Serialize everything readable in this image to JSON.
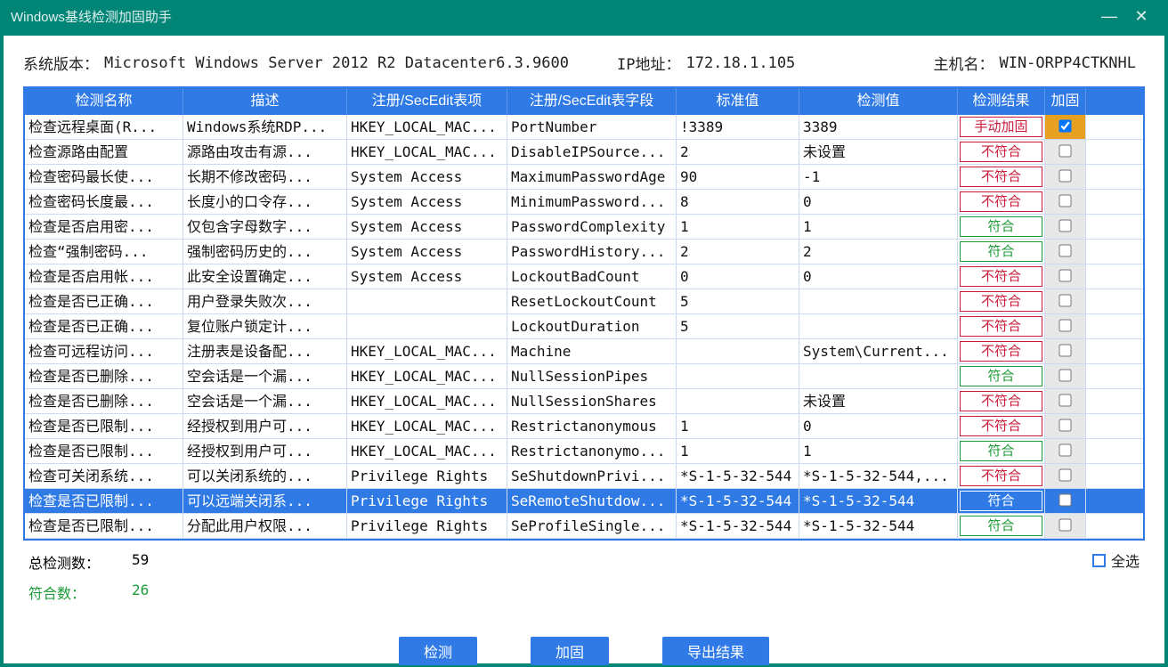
{
  "titlebar": {
    "title": "Windows基线检测加固助手"
  },
  "info": {
    "os_label": "系统版本：",
    "os_value": "Microsoft Windows Server 2012 R2 Datacenter6.3.9600",
    "ip_label": "IP地址：",
    "ip_value": "172.18.1.105",
    "host_label": "主机名：",
    "host_value": "WIN-ORPP4CTKNHL"
  },
  "columns": [
    "检测名称",
    "描述",
    "注册/SecEdit表项",
    "注册/SecEdit表字段",
    "标准值",
    "检测值",
    "检测结果",
    "加固"
  ],
  "results": {
    "ok": "符合",
    "bad": "不符合",
    "manual": "手动加固"
  },
  "rows": [
    {
      "name": "检查远程桌面(R...",
      "desc": "Windows系统RDP...",
      "reg": "HKEY_LOCAL_MAC...",
      "field": "PortNumber",
      "std": "!3389",
      "val": "3389",
      "res": "manual",
      "chk": true,
      "hl": true
    },
    {
      "name": "检查源路由配置",
      "desc": "源路由攻击有源...",
      "reg": "HKEY_LOCAL_MAC...",
      "field": "DisableIPSource...",
      "std": "2",
      "val": "未设置",
      "res": "bad",
      "chk": false
    },
    {
      "name": "检查密码最长使...",
      "desc": "长期不修改密码...",
      "reg": "System Access",
      "field": "MaximumPasswordAge",
      "std": "90",
      "val": "-1",
      "res": "bad",
      "chk": false
    },
    {
      "name": "检查密码长度最...",
      "desc": "长度小的口令存...",
      "reg": "System Access",
      "field": "MinimumPassword...",
      "std": "8",
      "val": "0",
      "res": "bad",
      "chk": false
    },
    {
      "name": "检查是否启用密...",
      "desc": "仅包含字母数字...",
      "reg": "System Access",
      "field": "PasswordComplexity",
      "std": "1",
      "val": "1",
      "res": "ok",
      "chk": false
    },
    {
      "name": "检查“强制密码...",
      "desc": "强制密码历史的...",
      "reg": "System Access",
      "field": "PasswordHistory...",
      "std": "2",
      "val": "2",
      "res": "ok",
      "chk": false
    },
    {
      "name": "检查是否启用帐...",
      "desc": "此安全设置确定...",
      "reg": "System Access",
      "field": "LockoutBadCount",
      "std": "0",
      "val": "0",
      "res": "bad",
      "chk": false
    },
    {
      "name": "检查是否已正确...",
      "desc": "用户登录失败次...",
      "reg": "",
      "field": "ResetLockoutCount",
      "std": "5",
      "val": "",
      "res": "bad",
      "chk": false
    },
    {
      "name": "检查是否已正确...",
      "desc": "复位账户锁定计...",
      "reg": "",
      "field": "LockoutDuration",
      "std": "5",
      "val": "",
      "res": "bad",
      "chk": false
    },
    {
      "name": "检查可远程访问...",
      "desc": "注册表是设备配...",
      "reg": "HKEY_LOCAL_MAC...",
      "field": "Machine",
      "std": "",
      "val": "System\\Current...",
      "res": "bad",
      "chk": false
    },
    {
      "name": "检查是否已删除...",
      "desc": "空会话是一个漏...",
      "reg": "HKEY_LOCAL_MAC...",
      "field": "NullSessionPipes",
      "std": "",
      "val": "",
      "res": "ok",
      "chk": false
    },
    {
      "name": "检查是否已删除...",
      "desc": "空会话是一个漏...",
      "reg": "HKEY_LOCAL_MAC...",
      "field": "NullSessionShares",
      "std": "",
      "val": "未设置",
      "res": "bad",
      "chk": false
    },
    {
      "name": "检查是否已限制...",
      "desc": "经授权到用户可...",
      "reg": "HKEY_LOCAL_MAC...",
      "field": "Restrictanonymous",
      "std": "1",
      "val": "0",
      "res": "bad",
      "chk": false
    },
    {
      "name": "检查是否已限制...",
      "desc": "经授权到用户可...",
      "reg": "HKEY_LOCAL_MAC...",
      "field": "Restrictanonymo...",
      "std": "1",
      "val": "1",
      "res": "ok",
      "chk": false
    },
    {
      "name": "检查可关闭系统...",
      "desc": "可以关闭系统的...",
      "reg": "Privilege Rights",
      "field": "SeShutdownPrivi...",
      "std": "*S-1-5-32-544",
      "val": "*S-1-5-32-544,...",
      "res": "bad",
      "chk": false
    },
    {
      "name": "检查是否已限制...",
      "desc": "可以远端关闭系...",
      "reg": "Privilege Rights",
      "field": "SeRemoteShutdow...",
      "std": "*S-1-5-32-544",
      "val": "*S-1-5-32-544",
      "res": "ok",
      "chk": false,
      "selected": true
    },
    {
      "name": "检查是否已限制...",
      "desc": "分配此用户权限...",
      "reg": "Privilege Rights",
      "field": "SeProfileSingle...",
      "std": "*S-1-5-32-544",
      "val": "*S-1-5-32-544",
      "res": "ok",
      "chk": false
    }
  ],
  "stats": {
    "total_label": "总检测数：",
    "total_value": "59",
    "ok_label": "符合数：",
    "ok_value": "26"
  },
  "select_all_label": "全选",
  "buttons": {
    "detect": "检测",
    "harden": "加固",
    "export": "导出结果"
  }
}
